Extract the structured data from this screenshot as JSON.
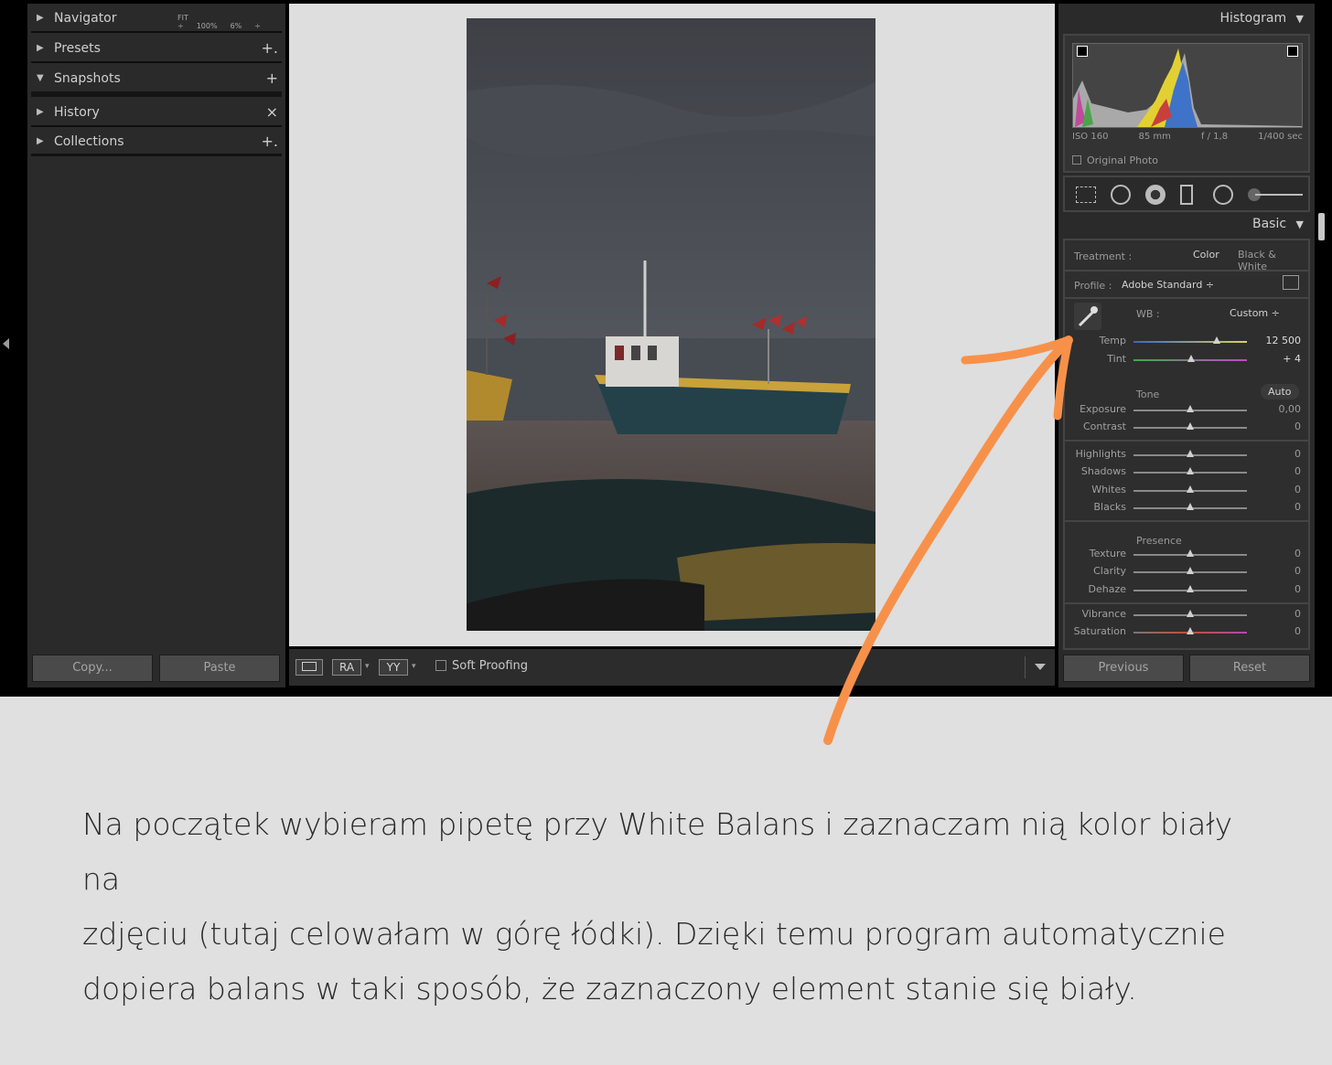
{
  "left_panel": {
    "items": [
      {
        "label": "Navigator",
        "action": ""
      },
      {
        "label": "Presets",
        "action": "+."
      },
      {
        "label": "Snapshots",
        "action": "+"
      },
      {
        "label": "History",
        "action": "×"
      },
      {
        "label": "Collections",
        "action": "+."
      }
    ],
    "navigator_fit": "FIT ÷",
    "navigator_zoom1": "100%",
    "navigator_zoom2": "6%",
    "navigator_more": "÷",
    "copy_label": "Copy...",
    "paste_label": "Paste"
  },
  "toolbar": {
    "ra_label": "RA",
    "yy_label": "YY",
    "soft_proofing": "Soft Proofing"
  },
  "right_panel": {
    "histogram_title": "Histogram",
    "iso": "ISO 160",
    "focal": "85 mm",
    "aperture": "f / 1,8",
    "shutter": "1/400 sec",
    "original_photo": "Original Photo",
    "basic_title": "Basic",
    "treatment_label": "Treatment :",
    "treatment_color": "Color",
    "treatment_bw": "Black & White",
    "profile_label": "Profile :",
    "profile_value": "Adobe Standard ÷",
    "wb_label": "WB :",
    "wb_value": "Custom ÷",
    "tone_label": "Tone",
    "auto_label": "Auto",
    "presence_label": "Presence",
    "sliders": [
      {
        "label": "Temp",
        "value": "12 500",
        "pos": 0.73
      },
      {
        "label": "Tint",
        "value": "+ 4",
        "pos": 0.51
      },
      {
        "label": "Exposure",
        "value": "0,00",
        "pos": 0.5
      },
      {
        "label": "Contrast",
        "value": "0",
        "pos": 0.5
      },
      {
        "label": "Highlights",
        "value": "0",
        "pos": 0.5
      },
      {
        "label": "Shadows",
        "value": "0",
        "pos": 0.5
      },
      {
        "label": "Whites",
        "value": "0",
        "pos": 0.5
      },
      {
        "label": "Blacks",
        "value": "0",
        "pos": 0.5
      },
      {
        "label": "Texture",
        "value": "0",
        "pos": 0.5
      },
      {
        "label": "Clarity",
        "value": "0",
        "pos": 0.5
      },
      {
        "label": "Dehaze",
        "value": "0",
        "pos": 0.5
      },
      {
        "label": "Vibrance",
        "value": "0",
        "pos": 0.5
      },
      {
        "label": "Saturation",
        "value": "0",
        "pos": 0.5
      }
    ],
    "previous_label": "Previous",
    "reset_label": "Reset"
  },
  "caption": {
    "line1": "Na początek wybieram pipetę przy White Balans i zaznaczam nią kolor biały na",
    "line2": "zdjęciu (tutaj celowałam w górę łódki). Dzięki temu program automatycznie",
    "line3": "dopiera balans w taki sposób, że zaznaczony element stanie się biały."
  },
  "colors": {
    "annotation_arrow": "#f7914a",
    "panel_bg": "#2a2a2a",
    "canvas_bg": "#dedede",
    "page_bg": "#e0e0e0"
  }
}
